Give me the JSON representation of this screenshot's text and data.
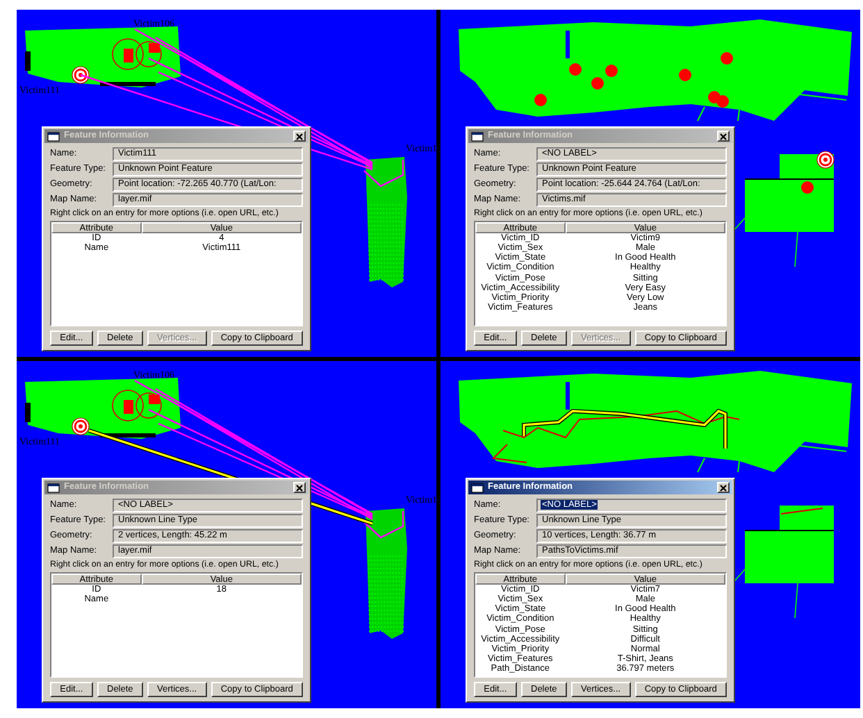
{
  "panels": [
    {
      "map": {
        "kind": "links",
        "labels": [
          "Victim106",
          "Victim111",
          "Victim1"
        ]
      },
      "dialog": {
        "title": "Feature Information",
        "active": false,
        "fields": [
          {
            "label": "Name:",
            "value": "Victim111",
            "selected": false
          },
          {
            "label": "Feature Type:",
            "value": "Unknown Point Feature",
            "selected": false
          },
          {
            "label": "Geometry:",
            "value": "Point location: -72.265 40.770 (Lat/Lon:",
            "selected": false
          },
          {
            "label": "Map Name:",
            "value": "layer.mif",
            "selected": false
          }
        ],
        "hint": "Right click on an entry for more options (i.e. open URL, etc.)",
        "columns": [
          "Attribute",
          "Value"
        ],
        "rows": [
          [
            "ID",
            "4"
          ],
          [
            "Name",
            "Victim111"
          ]
        ],
        "buttons": [
          {
            "label": "Edit...",
            "disabled": false
          },
          {
            "label": "Delete",
            "disabled": false
          },
          {
            "label": "Vertices...",
            "disabled": true
          },
          {
            "label": "Copy to Clipboard",
            "disabled": false
          }
        ]
      }
    },
    {
      "map": {
        "kind": "victims"
      },
      "dialog": {
        "title": "Feature Information",
        "active": false,
        "fields": [
          {
            "label": "Name:",
            "value": "<NO LABEL>",
            "selected": false
          },
          {
            "label": "Feature Type:",
            "value": "Unknown Point Feature",
            "selected": false
          },
          {
            "label": "Geometry:",
            "value": "Point location: -25.644 24.764 (Lat/Lon:",
            "selected": false
          },
          {
            "label": "Map Name:",
            "value": "Victims.mif",
            "selected": false
          }
        ],
        "hint": "Right click on an entry for more options (i.e. open URL, etc.)",
        "columns": [
          "Attribute",
          "Value"
        ],
        "rows": [
          [
            "Victim_ID",
            "Victim9"
          ],
          [
            "Victim_Sex",
            "Male"
          ],
          [
            "Victim_State",
            "In Good Health"
          ],
          [
            "Victim_Condition",
            "Healthy"
          ],
          [
            "Victim_Pose",
            "Sitting"
          ],
          [
            "Victim_Accessibility",
            "Very Easy"
          ],
          [
            "Victim_Priority",
            "Very Low"
          ],
          [
            "Victim_Features",
            "Jeans"
          ]
        ],
        "buttons": [
          {
            "label": "Edit...",
            "disabled": false
          },
          {
            "label": "Delete",
            "disabled": false
          },
          {
            "label": "Vertices...",
            "disabled": true
          },
          {
            "label": "Copy to Clipboard",
            "disabled": false
          }
        ]
      }
    },
    {
      "map": {
        "kind": "selected-link",
        "labels": [
          "Victim106",
          "Victim111",
          "Victim1"
        ]
      },
      "dialog": {
        "title": "Feature Information",
        "active": false,
        "fields": [
          {
            "label": "Name:",
            "value": "<NO LABEL>",
            "selected": false
          },
          {
            "label": "Feature Type:",
            "value": "Unknown Line Type",
            "selected": false
          },
          {
            "label": "Geometry:",
            "value": "2 vertices, Length: 45.22 m",
            "selected": false
          },
          {
            "label": "Map Name:",
            "value": "layer.mif",
            "selected": false
          }
        ],
        "hint": "Right click on an entry for more options (i.e. open URL, etc.)",
        "columns": [
          "Attribute",
          "Value"
        ],
        "rows": [
          [
            "ID",
            "18"
          ],
          [
            "Name"
          ]
        ],
        "buttons": [
          {
            "label": "Edit...",
            "disabled": false
          },
          {
            "label": "Delete",
            "disabled": false
          },
          {
            "label": "Vertices...",
            "disabled": false
          },
          {
            "label": "Copy to Clipboard",
            "disabled": false
          }
        ]
      }
    },
    {
      "map": {
        "kind": "paths"
      },
      "dialog": {
        "title": "Feature Information",
        "active": true,
        "fields": [
          {
            "label": "Name:",
            "value": "<NO LABEL>",
            "selected": true
          },
          {
            "label": "Feature Type:",
            "value": "Unknown Line Type",
            "selected": false
          },
          {
            "label": "Geometry:",
            "value": "10 vertices, Length: 36.77 m",
            "selected": false
          },
          {
            "label": "Map Name:",
            "value": "PathsToVictims.mif",
            "selected": false
          }
        ],
        "hint": "Right click on an entry for more options (i.e. open URL, etc.)",
        "columns": [
          "Attribute",
          "Value"
        ],
        "rows": [
          [
            "Victim_ID",
            "Victim7"
          ],
          [
            "Victim_Sex",
            "Male"
          ],
          [
            "Victim_State",
            "In Good Health"
          ],
          [
            "Victim_Condition",
            "Healthy"
          ],
          [
            "Victim_Pose",
            "Sitting"
          ],
          [
            "Victim_Accessibility",
            "Difficult"
          ],
          [
            "Victim_Priority",
            "Normal"
          ],
          [
            "Victim_Features",
            "T-Shirt, Jeans"
          ],
          [
            "Path_Distance",
            "36.797 meters"
          ]
        ],
        "buttons": [
          {
            "label": "Edit...",
            "disabled": false
          },
          {
            "label": "Delete",
            "disabled": false
          },
          {
            "label": "Vertices...",
            "disabled": false
          },
          {
            "label": "Copy to Clipboard",
            "disabled": false
          }
        ]
      }
    }
  ]
}
